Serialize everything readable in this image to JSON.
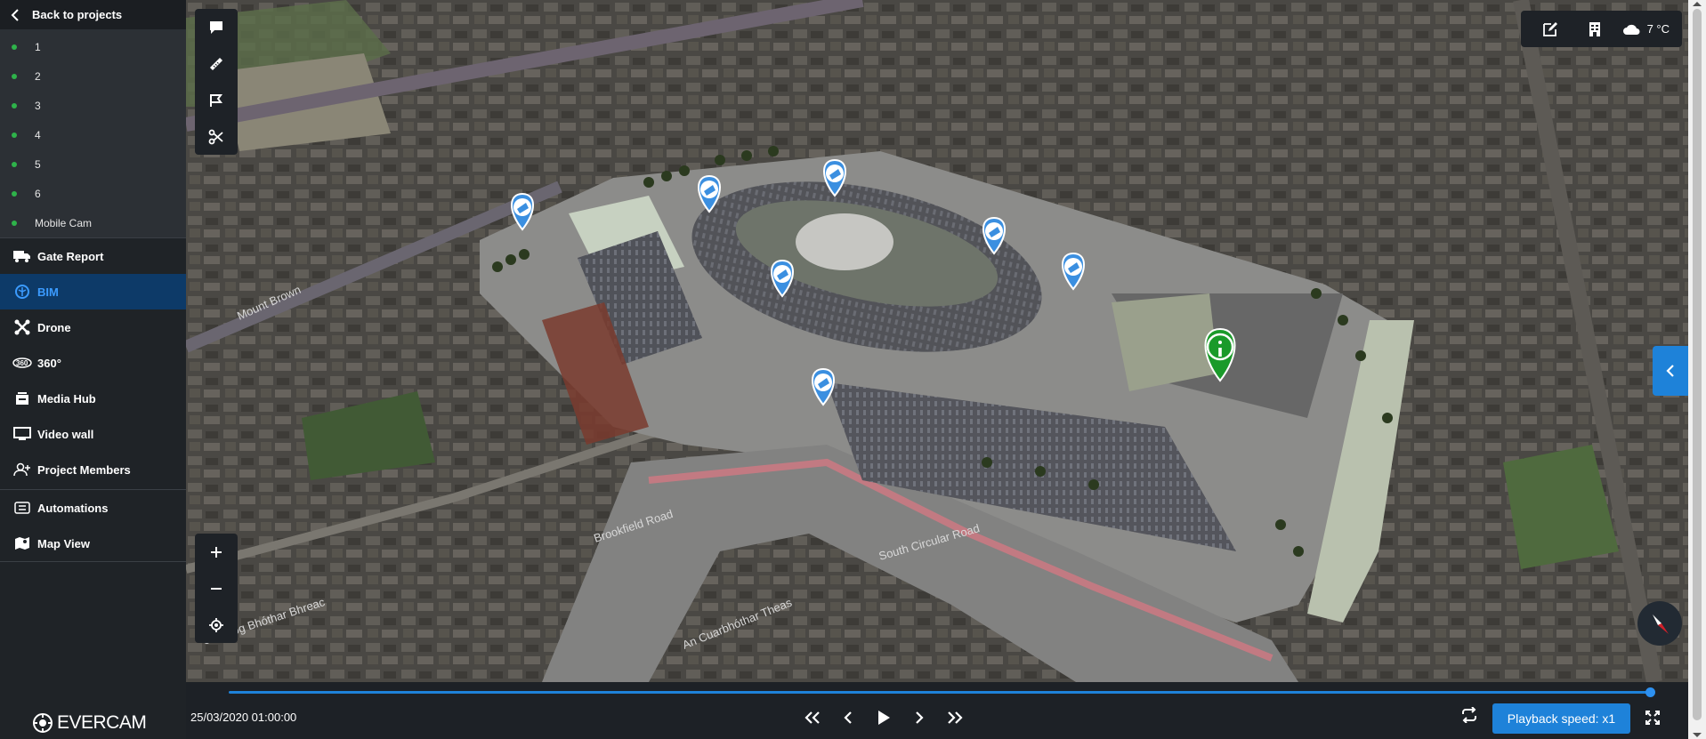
{
  "sidebar": {
    "back_label": "Back to projects",
    "cameras": [
      "1",
      "2",
      "3",
      "4",
      "5",
      "6",
      "Mobile Cam"
    ],
    "nav": [
      {
        "label": "Gate Report",
        "icon": "truck-icon"
      },
      {
        "label": "BIM",
        "icon": "bim-icon",
        "active": true
      },
      {
        "label": "Drone",
        "icon": "drone-icon"
      },
      {
        "label": "360°",
        "icon": "360-icon"
      },
      {
        "label": "Media Hub",
        "icon": "media-hub-icon"
      },
      {
        "label": "Video wall",
        "icon": "monitor-icon"
      },
      {
        "label": "Project Members",
        "icon": "add-user-icon"
      }
    ],
    "nav2": [
      {
        "label": "Automations",
        "icon": "automations-icon"
      },
      {
        "label": "Map View",
        "icon": "map-view-icon"
      }
    ],
    "logo_text": "EVERCAM"
  },
  "map": {
    "weather": "7 °C",
    "street_labels": [
      "Mount Brown",
      "Brookfield Road",
      "South Circular Road",
      "An Cuarbhóthar Theas",
      "Cearnóg Bhóthar Bhreac"
    ]
  },
  "playback": {
    "datetime": "25/03/2020 01:00:00",
    "speed_label": "Playback speed: x1",
    "progress": 1.0
  },
  "colors": {
    "accent": "#1e82d9",
    "marker_blue": "#3b8fe0",
    "marker_green": "#1a9a2a",
    "sidebar_bg": "#1f2327"
  }
}
